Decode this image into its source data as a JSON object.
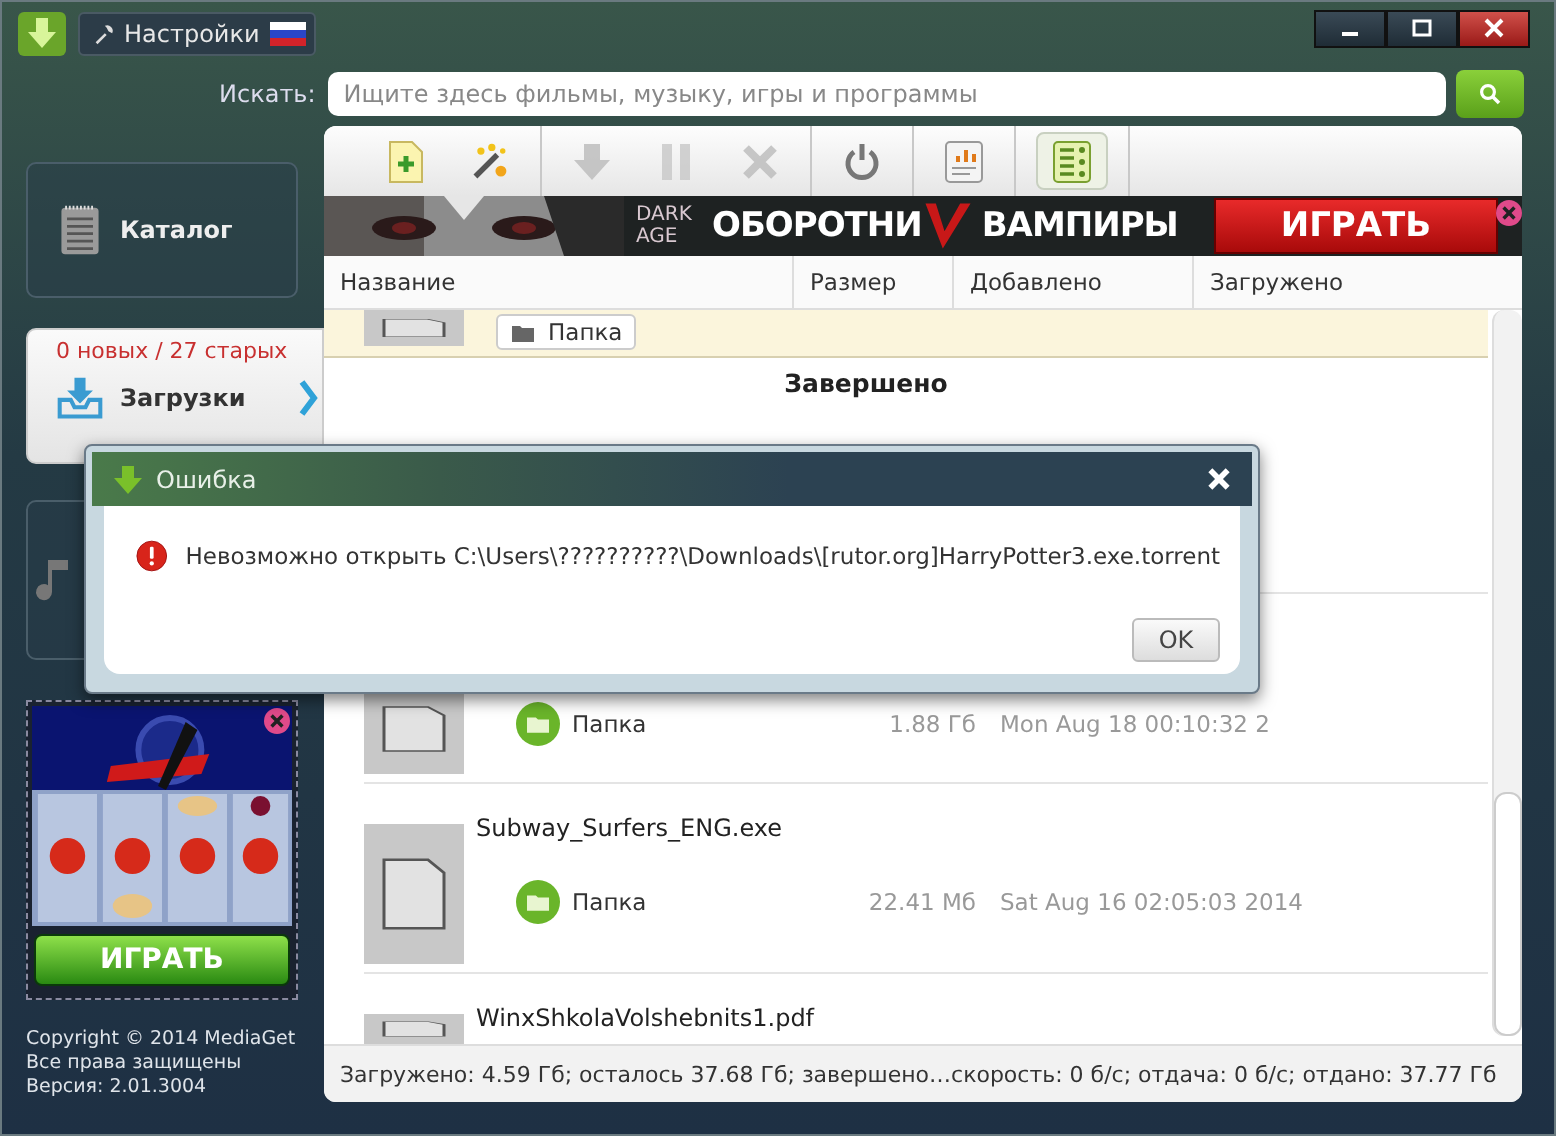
{
  "window": {
    "tab": "Настройки"
  },
  "search": {
    "label": "Искать:",
    "placeholder": "Ищите здесь фильмы, музыку, игры и программы"
  },
  "sidebar": {
    "items": [
      {
        "kind": "catalog",
        "label": "Каталог",
        "selected": false
      },
      {
        "kind": "downloads",
        "label": "Загрузки",
        "counter": "0 новых / 27 старых",
        "selected": true
      },
      {
        "kind": "music",
        "selected": false
      }
    ]
  },
  "side_ad": {
    "button": "ИГРАТЬ"
  },
  "footer": [
    "Copyright © 2014 MediaGet",
    "Все права защищены",
    "Версия: 2.01.3004"
  ],
  "toolbar": [
    {
      "kind": "add",
      "disabled": false,
      "selected": false
    },
    {
      "kind": "wand",
      "disabled": false,
      "selected": false
    },
    {
      "kind": "download",
      "disabled": true,
      "selected": false
    },
    {
      "kind": "pause",
      "disabled": true,
      "selected": false
    },
    {
      "kind": "stop",
      "disabled": true,
      "selected": false
    },
    {
      "kind": "power",
      "disabled": false,
      "selected": false
    },
    {
      "kind": "chart",
      "disabled": false,
      "selected": false
    },
    {
      "kind": "list",
      "disabled": false,
      "selected": true
    }
  ],
  "banner": {
    "logo": "DARK AGE",
    "title_left": "ОБОРОТНИ",
    "title_right": "ВАМПИРЫ",
    "button": "ИГРАТЬ"
  },
  "table": {
    "columns": [
      "Название",
      "Размер",
      "Добавлено",
      "Загружено"
    ],
    "rows": [
      {
        "kind": "file",
        "selected": true,
        "folder": "Папка"
      },
      {
        "kind": "group",
        "label": "Завершено"
      },
      {
        "kind": "file",
        "selected": false,
        "folder": "Папка",
        "size": "1.88 Гб",
        "added": "Mon Aug 18 00:10:32 2"
      },
      {
        "kind": "file",
        "selected": false,
        "name": "Subway_Surfers_ENG.exe",
        "folder": "Папка",
        "size": "22.41 Мб",
        "added": "Sat Aug 16 02:05:03 2014"
      },
      {
        "kind": "file",
        "selected": false,
        "name": "WinxShkolaVolshebnits1.pdf"
      }
    ]
  },
  "status_bar": "Загружено: 4.59 Гб; осталось 37.68 Гб; завершено…скорость: 0 б/с; отдача: 0 б/с; отдано: 37.77 Гб",
  "dialog": {
    "title": "Ошибка",
    "message": "Невозможно открыть C:\\Users\\??????????\\Downloads\\[rutor.org]HarryPotter3.exe.torrent",
    "button": "OK"
  }
}
